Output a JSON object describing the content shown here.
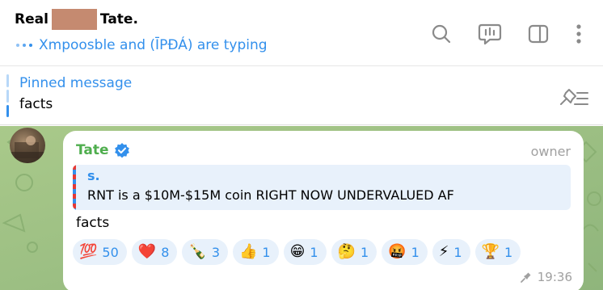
{
  "header": {
    "title_prefix": "Real",
    "title_suffix": "Tate.",
    "typing_text": "Xmpoosble and (ĪPĐÁ) are typing",
    "icons": [
      "search-icon",
      "video-chat-icon",
      "sidebar-toggle-icon",
      "more-options-icon"
    ]
  },
  "pinned": {
    "title": "Pinned message",
    "text": "facts",
    "icon": "unpin-list-icon"
  },
  "message": {
    "sender": "Tate",
    "role": "owner",
    "reply_name": "s.",
    "reply_text": "RNT is a $10M-$15M coin  RIGHT NOW  UNDERVALUED AF",
    "text": "facts",
    "time": "19:36",
    "reactions": [
      {
        "emoji": "💯",
        "count": "50"
      },
      {
        "emoji": "❤️",
        "count": "8"
      },
      {
        "emoji": "🍾",
        "count": "3"
      },
      {
        "emoji": "👍",
        "count": "1"
      },
      {
        "emoji": "😁",
        "count": "1"
      },
      {
        "emoji": "🤔",
        "count": "1"
      },
      {
        "emoji": "🤬",
        "count": "1"
      },
      {
        "emoji": "⚡",
        "count": "1"
      },
      {
        "emoji": "🏆",
        "count": "1"
      }
    ]
  },
  "colors": {
    "accent": "#3390ec",
    "sender": "#4fae4e",
    "chat_background": "#9cbf85",
    "reaction_background": "#e8f1fb"
  }
}
